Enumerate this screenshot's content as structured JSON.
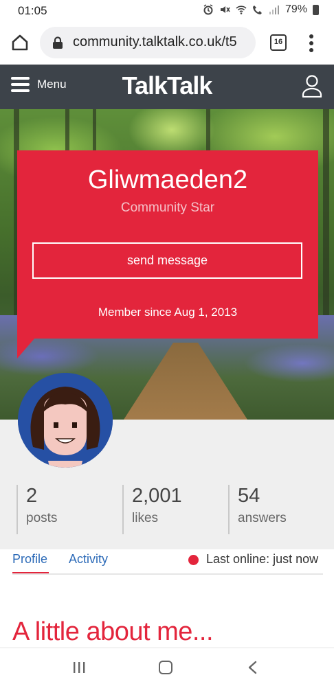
{
  "status_bar": {
    "time": "01:05",
    "battery": "79%"
  },
  "browser": {
    "url": "community.talktalk.co.uk/t5",
    "tab_count": "16"
  },
  "header": {
    "menu_label": "Menu",
    "logo": "TalkTalk"
  },
  "profile": {
    "username": "Gliwmaeden2",
    "rank": "Community Star",
    "send_message_label": "send message",
    "member_since": "Member since Aug 1, 2013"
  },
  "stats": [
    {
      "value": "2",
      "label": "posts"
    },
    {
      "value": "2,001",
      "label": "likes"
    },
    {
      "value": "54",
      "label": "answers"
    }
  ],
  "tabs": [
    {
      "label": "Profile",
      "active": true
    },
    {
      "label": "Activity",
      "active": false
    }
  ],
  "online_status": "Last online: just now",
  "about_heading": "A little about me...",
  "colors": {
    "brand_red": "#e3253c",
    "header_dark": "#3d434a",
    "link_blue": "#2d6bb8",
    "avatar_blue": "#2650a4"
  }
}
